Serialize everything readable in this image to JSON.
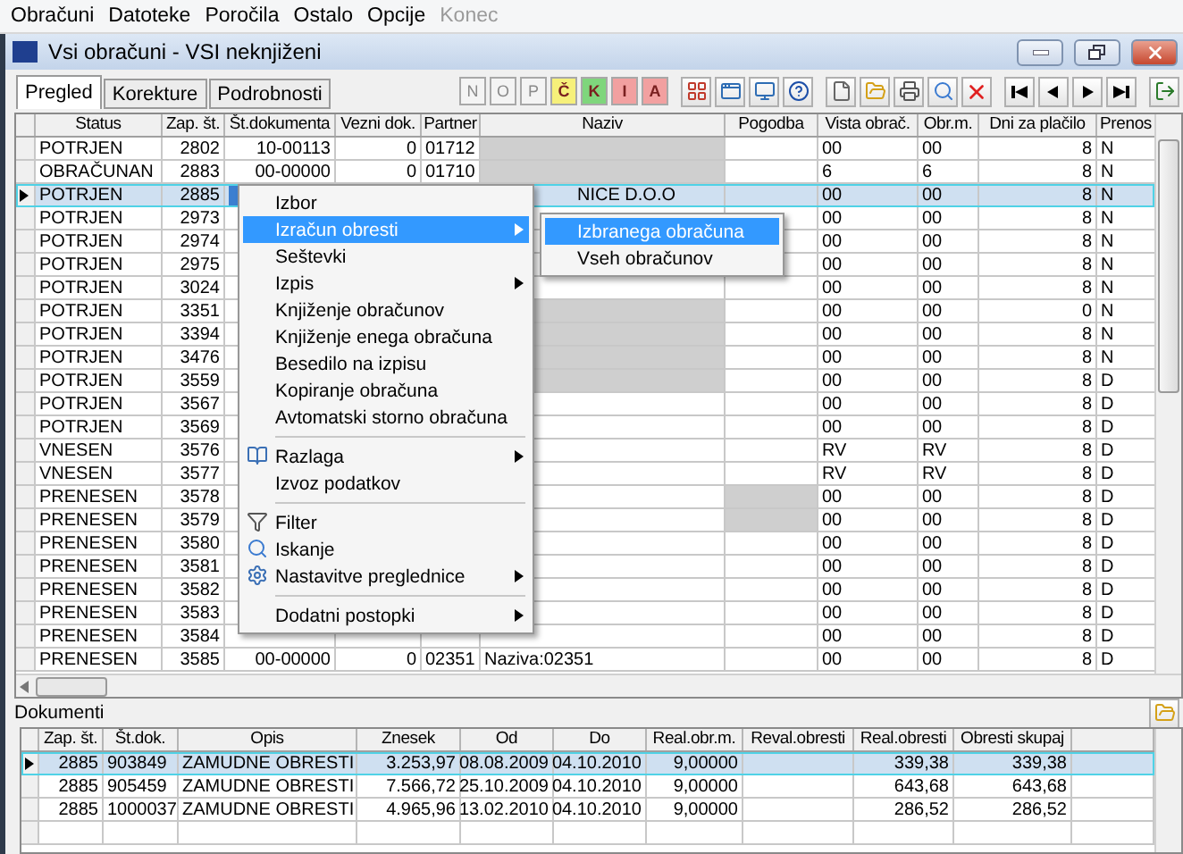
{
  "menu_bar": [
    {
      "label": "Obračuni",
      "disabled": false
    },
    {
      "label": "Datoteke",
      "disabled": false
    },
    {
      "label": "Poročila",
      "disabled": false
    },
    {
      "label": "Ostalo",
      "disabled": false
    },
    {
      "label": "Opcije",
      "disabled": false
    },
    {
      "label": "Konec",
      "disabled": true
    }
  ],
  "window": {
    "title": "Vsi obračuni - VSI neknjiženi"
  },
  "tabs": [
    {
      "label": "Pregled",
      "selected": true
    },
    {
      "label": "Korekture",
      "selected": false
    },
    {
      "label": "Podrobnosti",
      "selected": false
    }
  ],
  "letter_buttons": [
    {
      "label": "N",
      "color": "#f4f4f4",
      "disabled": true
    },
    {
      "label": "O",
      "color": "#f4f4f4",
      "disabled": true
    },
    {
      "label": "P",
      "color": "#f4f4f4",
      "disabled": true
    },
    {
      "label": "Č",
      "color": "#f6f07a",
      "disabled": false
    },
    {
      "label": "K",
      "color": "#7fd67c",
      "disabled": false
    },
    {
      "label": "I",
      "color": "#f2a0a0",
      "disabled": false
    },
    {
      "label": "A",
      "color": "#f2a0a0",
      "disabled": false
    }
  ],
  "main_table": {
    "columns": [
      "Status",
      "Zap. št.",
      "Št.dokumenta",
      "Vezni dok.",
      "Partner",
      "Naziv",
      "Pogodba",
      "Vista obrač.",
      "Obr.m.",
      "Dni za plačilo",
      "Prenos"
    ],
    "rows": [
      {
        "status": "POTRJEN",
        "zap": "2802",
        "doc": "10-00113",
        "vezni": "0",
        "partner": "01712",
        "vista": "00",
        "obr": "00",
        "dni": "8",
        "prenos": "N",
        "selected": false,
        "naziv_redacted": true,
        "pogodba_redacted": false
      },
      {
        "status": "OBRAČUNAN",
        "zap": "2883",
        "doc": "00-00000",
        "vezni": "0",
        "partner": "01710",
        "vista": "6",
        "obr": "6",
        "dni": "8",
        "prenos": "N",
        "selected": false,
        "naziv_redacted": true,
        "pogodba_redacted": false
      },
      {
        "status": "POTRJEN",
        "zap": "2885",
        "naziv": "NICE D.O.O",
        "vista": "00",
        "obr": "00",
        "dni": "8",
        "prenos": "N",
        "selected": true,
        "naziv_redacted": false,
        "pogodba_redacted": false
      },
      {
        "status": "POTRJEN",
        "zap": "2973",
        "vista": "00",
        "obr": "00",
        "dni": "8",
        "prenos": "N",
        "selected": false,
        "naziv_redacted": false,
        "pogodba_redacted": false
      },
      {
        "status": "POTRJEN",
        "zap": "2974",
        "vista": "00",
        "obr": "00",
        "dni": "8",
        "prenos": "N",
        "selected": false,
        "naziv_redacted": false,
        "pogodba_redacted": false
      },
      {
        "status": "POTRJEN",
        "zap": "2975",
        "vista": "00",
        "obr": "00",
        "dni": "8",
        "prenos": "N",
        "selected": false,
        "naziv_redacted": false,
        "pogodba_redacted": false
      },
      {
        "status": "POTRJEN",
        "zap": "3024",
        "vista": "00",
        "obr": "00",
        "dni": "8",
        "prenos": "N",
        "selected": false,
        "naziv_redacted": false,
        "pogodba_redacted": false
      },
      {
        "status": "POTRJEN",
        "zap": "3351",
        "vista": "00",
        "obr": "00",
        "dni": "0",
        "prenos": "N",
        "selected": false,
        "naziv_redacted": true,
        "pogodba_redacted": false
      },
      {
        "status": "POTRJEN",
        "zap": "3394",
        "vista": "00",
        "obr": "00",
        "dni": "8",
        "prenos": "N",
        "selected": false,
        "naziv_redacted": true,
        "pogodba_redacted": false
      },
      {
        "status": "POTRJEN",
        "zap": "3476",
        "vista": "00",
        "obr": "00",
        "dni": "8",
        "prenos": "N",
        "selected": false,
        "naziv_redacted": true,
        "pogodba_redacted": false
      },
      {
        "status": "POTRJEN",
        "zap": "3559",
        "vista": "00",
        "obr": "00",
        "dni": "8",
        "prenos": "D",
        "selected": false,
        "naziv_redacted": true,
        "pogodba_redacted": false
      },
      {
        "status": "POTRJEN",
        "zap": "3567",
        "vista": "00",
        "obr": "00",
        "dni": "8",
        "prenos": "D",
        "selected": false,
        "naziv_redacted": false,
        "pogodba_redacted": false
      },
      {
        "status": "POTRJEN",
        "zap": "3569",
        "vista": "00",
        "obr": "00",
        "dni": "8",
        "prenos": "D",
        "selected": false,
        "naziv_redacted": false,
        "pogodba_redacted": false
      },
      {
        "status": "VNESEN",
        "zap": "3576",
        "vista": "RV",
        "obr": "RV",
        "dni": "8",
        "prenos": "D",
        "selected": false,
        "naziv_redacted": false,
        "pogodba_redacted": false
      },
      {
        "status": "VNESEN",
        "zap": "3577",
        "vista": "RV",
        "obr": "RV",
        "dni": "8",
        "prenos": "D",
        "selected": false,
        "naziv_redacted": false,
        "pogodba_redacted": false
      },
      {
        "status": "PRENESEN",
        "zap": "3578",
        "vista": "00",
        "obr": "00",
        "dni": "8",
        "prenos": "D",
        "selected": false,
        "naziv_redacted": false,
        "pogodba_redacted": true
      },
      {
        "status": "PRENESEN",
        "zap": "3579",
        "vista": "00",
        "obr": "00",
        "dni": "8",
        "prenos": "D",
        "selected": false,
        "naziv_redacted": false,
        "pogodba_redacted": true
      },
      {
        "status": "PRENESEN",
        "zap": "3580",
        "vista": "00",
        "obr": "00",
        "dni": "8",
        "prenos": "D",
        "selected": false,
        "naziv_redacted": false,
        "pogodba_redacted": false
      },
      {
        "status": "PRENESEN",
        "zap": "3581",
        "vista": "00",
        "obr": "00",
        "dni": "8",
        "prenos": "D",
        "selected": false,
        "naziv_redacted": false,
        "pogodba_redacted": false
      },
      {
        "status": "PRENESEN",
        "zap": "3582",
        "vista": "00",
        "obr": "00",
        "dni": "8",
        "prenos": "D",
        "selected": false,
        "naziv_redacted": false,
        "pogodba_redacted": false
      },
      {
        "status": "PRENESEN",
        "zap": "3583",
        "vista": "00",
        "obr": "00",
        "dni": "8",
        "prenos": "D",
        "selected": false,
        "naziv_redacted": false,
        "pogodba_redacted": false
      },
      {
        "status": "PRENESEN",
        "zap": "3584",
        "vista": "00",
        "obr": "00",
        "dni": "8",
        "prenos": "D",
        "selected": false,
        "naziv_redacted": false,
        "pogodba_redacted": false
      },
      {
        "status": "PRENESEN",
        "zap": "3585",
        "doc": "00-00000",
        "vezni": "0",
        "partner": "02351",
        "naziv": "Naziva:02351",
        "vista": "00",
        "obr": "00",
        "dni": "8",
        "prenos": "D",
        "selected": false,
        "naziv_redacted": false,
        "pogodba_redacted": false
      }
    ]
  },
  "context_menu": {
    "items": [
      {
        "kind": "item",
        "label": "Izbor",
        "has_submenu": false,
        "selected": false
      },
      {
        "kind": "item",
        "label": "Izračun obresti",
        "has_submenu": true,
        "selected": true
      },
      {
        "kind": "item",
        "label": "Seštevki",
        "has_submenu": false,
        "selected": false
      },
      {
        "kind": "item",
        "label": "Izpis",
        "has_submenu": true,
        "selected": false
      },
      {
        "kind": "item",
        "label": "Knjiženje obračunov",
        "has_submenu": false,
        "selected": false
      },
      {
        "kind": "item",
        "label": "Knjiženje enega obračuna",
        "has_submenu": false,
        "selected": false
      },
      {
        "kind": "item",
        "label": "Besedilo na izpisu",
        "has_submenu": false,
        "selected": false
      },
      {
        "kind": "item",
        "label": "Kopiranje obračuna",
        "has_submenu": false,
        "selected": false
      },
      {
        "kind": "item",
        "label": "Avtomatski storno obračuna",
        "has_submenu": false,
        "selected": false
      },
      {
        "kind": "separator"
      },
      {
        "kind": "item",
        "label": "Razlaga",
        "has_submenu": true,
        "selected": false
      },
      {
        "kind": "item",
        "label": "Izvoz podatkov",
        "has_submenu": false,
        "selected": false
      },
      {
        "kind": "separator"
      },
      {
        "kind": "item",
        "label": "Filter",
        "has_submenu": false,
        "selected": false
      },
      {
        "kind": "item",
        "label": "Iskanje",
        "has_submenu": false,
        "selected": false
      },
      {
        "kind": "item",
        "label": "Nastavitve preglednice",
        "has_submenu": true,
        "selected": false
      },
      {
        "kind": "separator"
      },
      {
        "kind": "item",
        "label": "Dodatni postopki",
        "has_submenu": true,
        "selected": false
      }
    ]
  },
  "submenu": {
    "items": [
      {
        "label": "Izbranega obračuna",
        "selected": true
      },
      {
        "label": "Vseh obračunov",
        "selected": false
      }
    ]
  },
  "documents": {
    "title": "Dokumenti",
    "columns": [
      "Zap. št.",
      "Št.dok.",
      "Opis",
      "Znesek",
      "Od",
      "Do",
      "Real.obr.m.",
      "Reval.obresti",
      "Real.obresti",
      "Obresti skupaj"
    ],
    "rows": [
      {
        "zap": "2885",
        "stdok": "903849",
        "opis": "ZAMUDNE OBRESTI",
        "znesek": "3.253,97",
        "od": "08.08.2009",
        "do": "04.10.2010",
        "realobrm": "9,00000",
        "realobr": "339,38",
        "skupaj": "339,38",
        "selected": true
      },
      {
        "zap": "2885",
        "stdok": "905459",
        "opis": "ZAMUDNE OBRESTI",
        "znesek": "7.566,72",
        "od": "25.10.2009",
        "do": "04.10.2010",
        "realobrm": "9,00000",
        "realobr": "643,68",
        "skupaj": "643,68",
        "selected": false
      },
      {
        "zap": "2885",
        "stdok": "1000037",
        "opis": "ZAMUDNE OBRESTI",
        "znesek": "4.965,96",
        "od": "13.02.2010",
        "do": "04.10.2010",
        "realobrm": "9,00000",
        "realobr": "286,52",
        "skupaj": "286,52",
        "selected": false
      }
    ]
  }
}
